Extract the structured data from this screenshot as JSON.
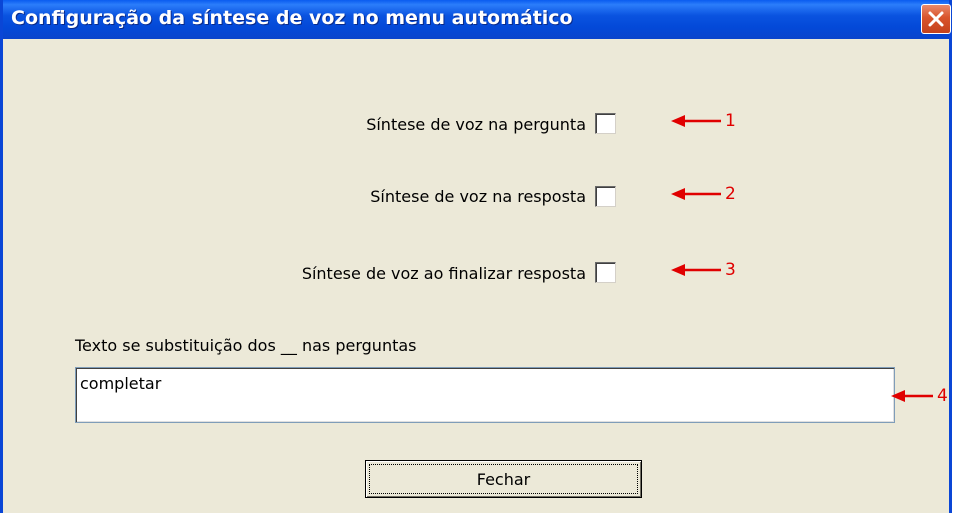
{
  "window": {
    "title": "Configuração da síntese de voz no menu automático"
  },
  "options": [
    {
      "label": "Síntese de voz na pergunta",
      "checked": false,
      "annotation": "1"
    },
    {
      "label": "Síntese de voz na resposta",
      "checked": false,
      "annotation": "2"
    },
    {
      "label": "Síntese de voz ao finalizar resposta",
      "checked": false,
      "annotation": "3"
    }
  ],
  "replacement": {
    "label": "Texto se substituição dos __ nas perguntas",
    "value": "completar",
    "annotation": "4"
  },
  "buttons": {
    "close_label": "Fechar"
  },
  "colors": {
    "titlebar": "#0a53e0",
    "dialog_bg": "#ece9d8",
    "annotation_red": "#e00000",
    "close_button": "#d9542c"
  }
}
